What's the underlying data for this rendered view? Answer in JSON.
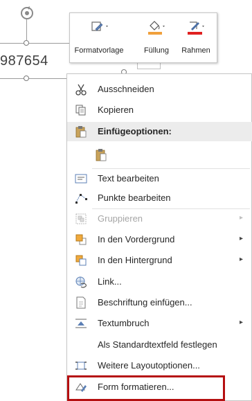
{
  "canvas": {
    "shape_text": "987654"
  },
  "minibar": {
    "buttons": [
      {
        "label": "Formatvorlage",
        "icon": "shape-style-icon"
      },
      {
        "label": "Füllung",
        "icon": "fill-bucket-icon",
        "color": "#f0a03c"
      },
      {
        "label": "Rahmen",
        "icon": "outline-pen-icon",
        "color": "#e02020"
      }
    ]
  },
  "menu": {
    "items": [
      {
        "label": "Ausschneiden",
        "icon": "scissors-icon"
      },
      {
        "label": "Kopieren",
        "icon": "copy-icon"
      },
      {
        "label": "Einfügeoptionen:",
        "icon": "paste-icon"
      },
      {
        "label": "",
        "icon": "paste-option-icon"
      },
      {
        "label": "Text bearbeiten",
        "icon": "edit-text-icon"
      },
      {
        "label": "Punkte bearbeiten",
        "icon": "edit-points-icon"
      },
      {
        "label": "Gruppieren",
        "icon": "group-icon",
        "disabled": true,
        "has_submenu": true
      },
      {
        "label": "In den Vordergrund",
        "icon": "bring-forward-icon",
        "has_submenu": true
      },
      {
        "label": "In den Hintergrund",
        "icon": "send-backward-icon",
        "has_submenu": true
      },
      {
        "label": "Link...",
        "icon": "link-icon"
      },
      {
        "label": "Beschriftung einfügen...",
        "icon": "insert-caption-icon"
      },
      {
        "label": "Textumbruch",
        "icon": "wrap-text-icon",
        "has_submenu": true
      },
      {
        "label": "Als Standardtextfeld festlegen",
        "icon": ""
      },
      {
        "label": "Weitere Layoutoptionen...",
        "icon": "layout-options-icon"
      },
      {
        "label": "Form formatieren...",
        "icon": "format-shape-icon",
        "highlighted": true
      }
    ],
    "submenu_arrow": "▸",
    "highlight_color": "#b50f10"
  }
}
